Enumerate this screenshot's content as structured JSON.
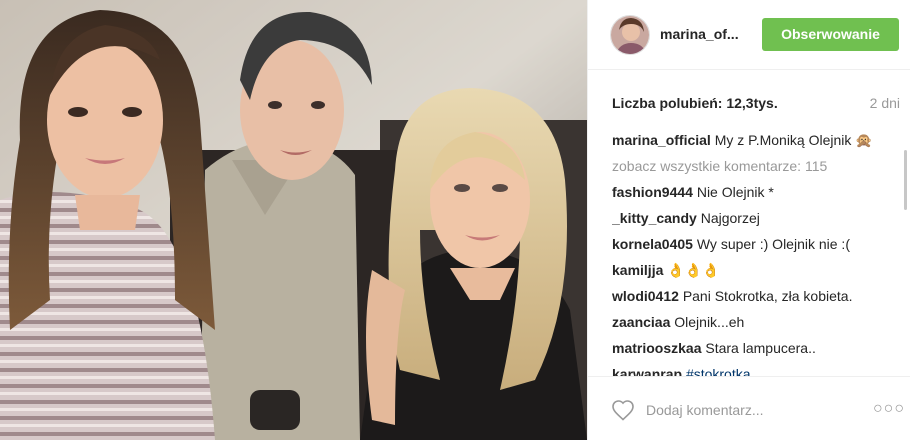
{
  "header": {
    "username": "marina_of...",
    "follow_label": "Obserwowanie"
  },
  "post": {
    "likes_label": "Liczba polubień:",
    "likes_count": "12,3tys.",
    "time_ago": "2 dni"
  },
  "caption": {
    "author": "marina_official",
    "text": "My z P.Moniką Olejnik",
    "emoji": "🙊"
  },
  "view_all": "zobacz wszystkie komentarze: 115",
  "comments": [
    {
      "author": "fashion9444",
      "text": "Nie Olejnik *"
    },
    {
      "author": "_kitty_candy",
      "text": "Najgorzej"
    },
    {
      "author": "kornela0405",
      "text": "Wy super :) Olejnik nie :("
    },
    {
      "author": "kamiljja",
      "text": "👌👌👌"
    },
    {
      "author": "wlodi0412",
      "text": "Pani Stokrotka, zła kobieta."
    },
    {
      "author": "zaanciaa",
      "text": "Olejnik...eh"
    },
    {
      "author": "matriooszkaa",
      "text": "Stara lampucera.."
    },
    {
      "author": "karwanrap",
      "text": "#stokrotka"
    }
  ],
  "footer": {
    "add_comment_placeholder": "Dodaj komentarz...",
    "more_label": "○○○"
  },
  "icons": {
    "heart": "heart-icon",
    "more": "more-options-icon"
  },
  "colors": {
    "follow_button": "#70c050",
    "hashtag": "#003569",
    "muted_text": "#999999"
  }
}
